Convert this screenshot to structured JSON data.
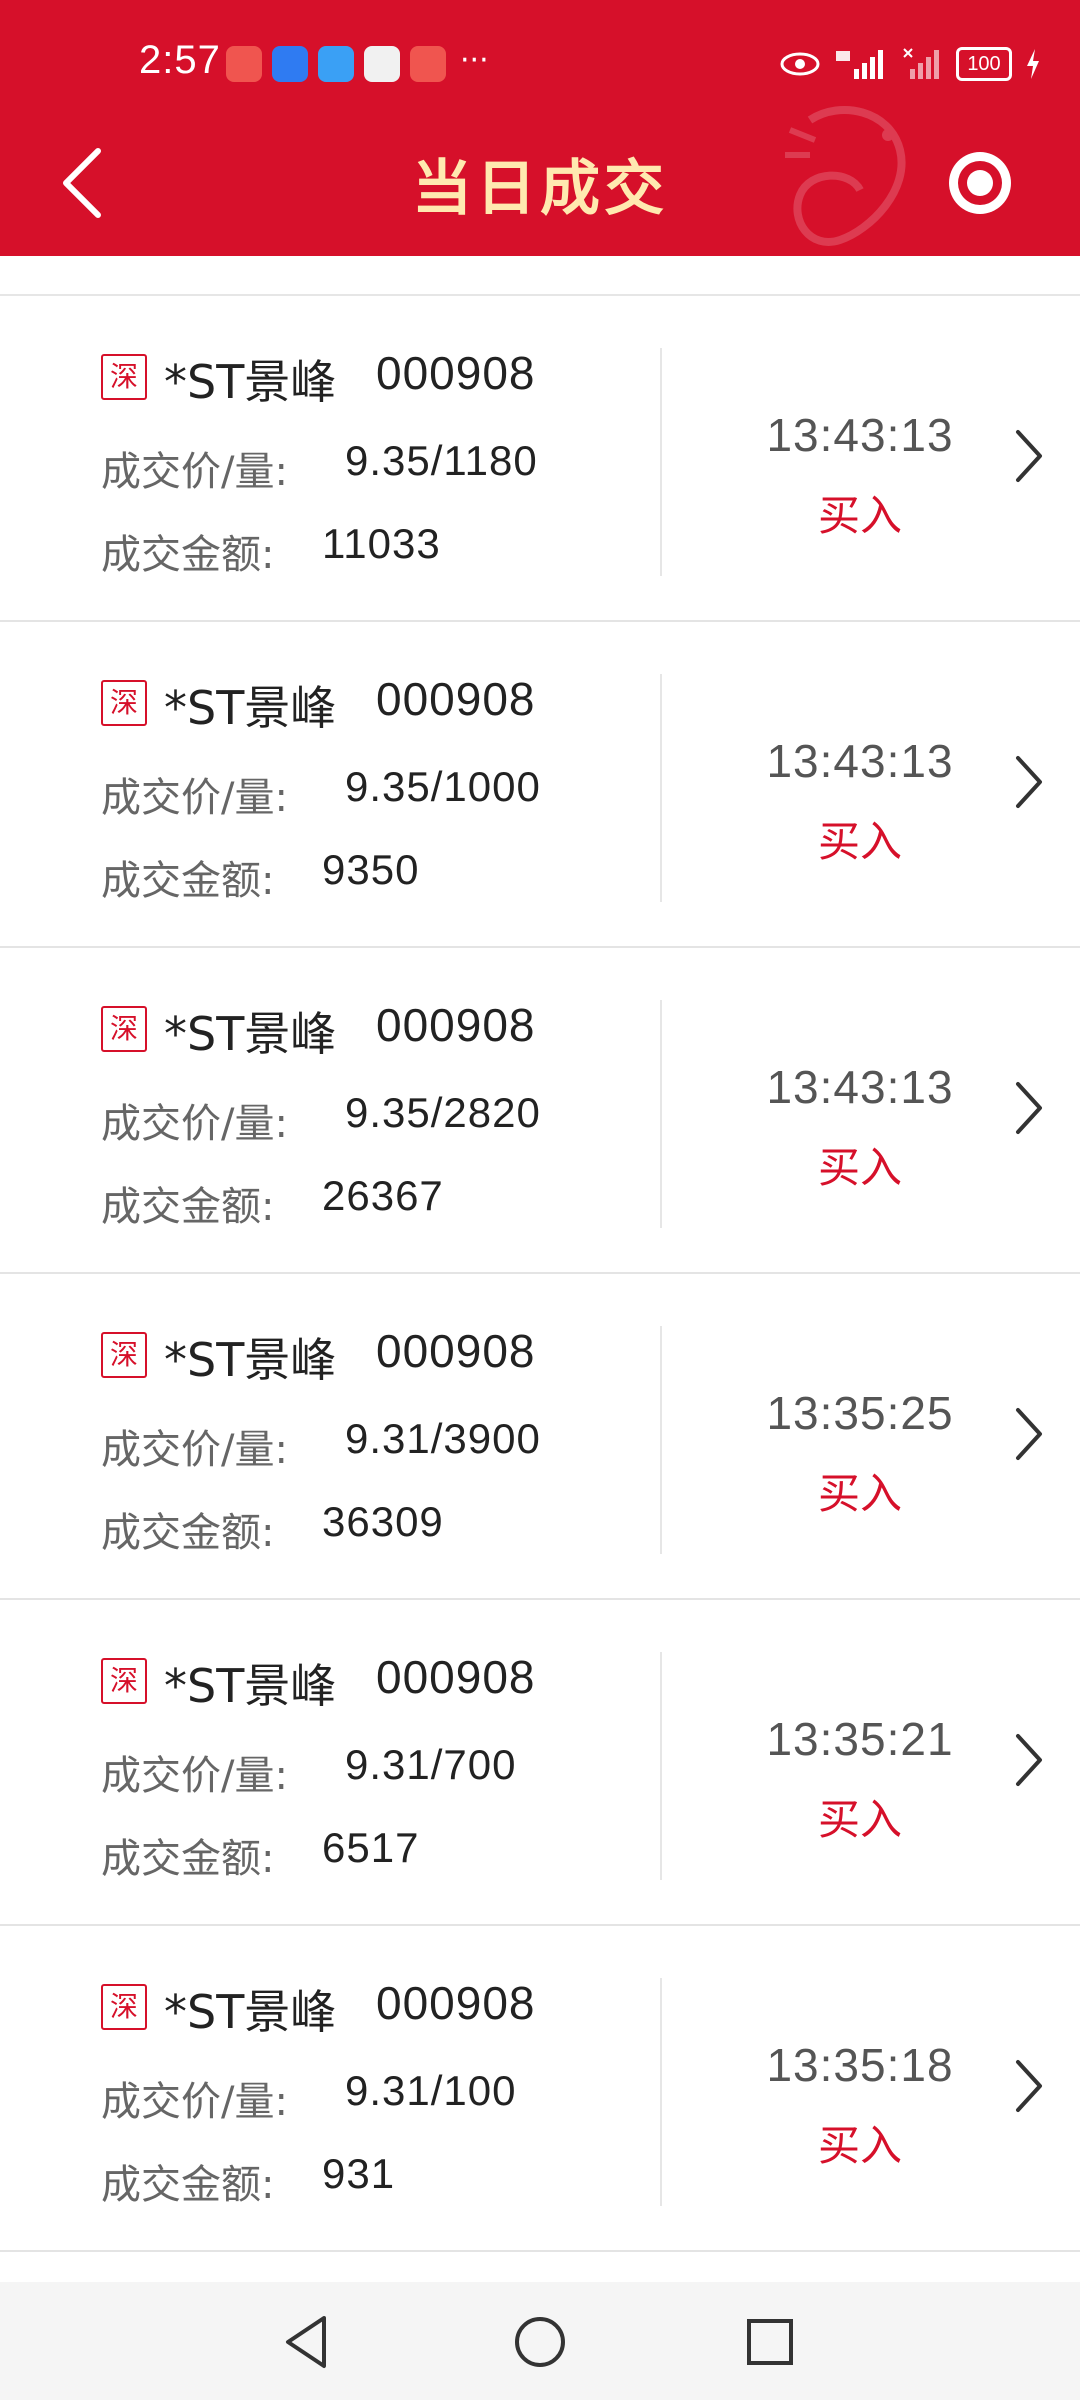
{
  "status_bar": {
    "time": "2:57",
    "more_indicator": "···",
    "battery": "100",
    "notification_icons": [
      "huawei-store-icon",
      "weather-icon",
      "cloud-icon",
      "reader-icon",
      "huawei-store-icon"
    ]
  },
  "header": {
    "title": "当日成交",
    "back_icon": "chevron-left-icon",
    "right_icon": "record-target-icon"
  },
  "trades": [
    {
      "market": "深",
      "name": "*ST景峰",
      "code": "000908",
      "price_label": "成交价/量:",
      "price_qty": "9.35/1180",
      "amount_label": "成交金额:",
      "amount": "11033",
      "time": "13:43:13",
      "side": "买入"
    },
    {
      "market": "深",
      "name": "*ST景峰",
      "code": "000908",
      "price_label": "成交价/量:",
      "price_qty": "9.35/1000",
      "amount_label": "成交金额:",
      "amount": "9350",
      "time": "13:43:13",
      "side": "买入"
    },
    {
      "market": "深",
      "name": "*ST景峰",
      "code": "000908",
      "price_label": "成交价/量:",
      "price_qty": "9.35/2820",
      "amount_label": "成交金额:",
      "amount": "26367",
      "time": "13:43:13",
      "side": "买入"
    },
    {
      "market": "深",
      "name": "*ST景峰",
      "code": "000908",
      "price_label": "成交价/量:",
      "price_qty": "9.31/3900",
      "amount_label": "成交金额:",
      "amount": "36309",
      "time": "13:35:25",
      "side": "买入"
    },
    {
      "market": "深",
      "name": "*ST景峰",
      "code": "000908",
      "price_label": "成交价/量:",
      "price_qty": "9.31/700",
      "amount_label": "成交金额:",
      "amount": "6517",
      "time": "13:35:21",
      "side": "买入"
    },
    {
      "market": "深",
      "name": "*ST景峰",
      "code": "000908",
      "price_label": "成交价/量:",
      "price_qty": "9.31/100",
      "amount_label": "成交金额:",
      "amount": "931",
      "time": "13:35:18",
      "side": "买入"
    }
  ],
  "colors": {
    "brand_red": "#d6102a",
    "title_gold": "#ffe9b0"
  }
}
